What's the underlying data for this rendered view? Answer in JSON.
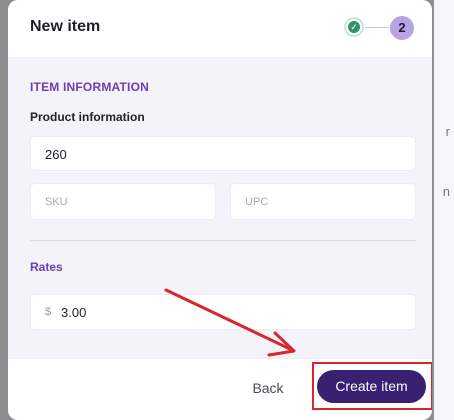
{
  "modal": {
    "title": "New item",
    "steps": {
      "completed_icon": "check-icon",
      "current_number": "2"
    }
  },
  "section": {
    "title": "ITEM INFORMATION",
    "product_heading": "Product information",
    "product_value": "260",
    "sku_placeholder": "SKU",
    "upc_placeholder": "UPC",
    "rates_heading": "Rates",
    "currency_symbol": "$",
    "rate_value": "3.00"
  },
  "footer": {
    "back_label": "Back",
    "create_label": "Create item"
  },
  "colors": {
    "accent": "#6a3fb0",
    "primary_button": "#3a2070",
    "annotation_red": "#d8262e",
    "step_complete": "#2f9467",
    "step_current": "#b9a4e3"
  },
  "annotation": {
    "icon": "red-arrow-icon",
    "target": "create-item-button"
  }
}
